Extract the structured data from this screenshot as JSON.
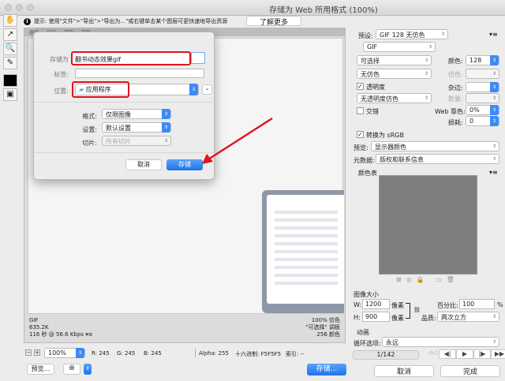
{
  "window": {
    "title": "存储为 Web 所用格式 (100%)"
  },
  "hint": {
    "text": "提示: 使用\"文件\">\"导出\">\"导出为...\"或右键单击某个图层可更快速地导出资源",
    "learn_more": "了解更多"
  },
  "tabs": [
    "原稿",
    "优化",
    "双联",
    "四联"
  ],
  "dialog": {
    "save_as_label": "存储为",
    "save_as_value": "翻书动态效果gif",
    "tags_label": "标签:",
    "location_label": "位置:",
    "location_value": "应用程序",
    "format_label": "格式:",
    "format_value": "仅限图像",
    "settings_label": "设置:",
    "settings_value": "默认设置",
    "slices_label": "切片:",
    "slices_value": "所有切片",
    "cancel": "取消",
    "save": "存储"
  },
  "image_info": {
    "format": "GIF",
    "size": "635.2K",
    "time": "116 秒 @ 56.6 Kbps",
    "dither": "100% 仿色",
    "palette": "\"可选择\" 调板",
    "colors": "256 颜色"
  },
  "status": {
    "zoom": "100%",
    "r": "R: 245",
    "g": "G: 245",
    "b": "B: 245",
    "alpha": "Alpha: 255",
    "hex": "十六进制: F5F5F5",
    "index": "索引: --"
  },
  "bottom": {
    "preview": "预览...",
    "save": "存储...",
    "cancel": "取消",
    "done": "完成"
  },
  "panel": {
    "preset_label": "预设:",
    "preset": "GIF 128 无仿色",
    "format": "GIF",
    "reduction": "可选择",
    "colors_label": "颜色:",
    "colors": "128",
    "dither_algo": "无仿色",
    "dither_label": "仿色:",
    "transparency": "透明度",
    "matte_label": "杂边:",
    "trans_dither": "无透明度仿色",
    "amount_label": "数量:",
    "interlaced": "交错",
    "web_snap_label": "Web 靠色:",
    "web_snap": "0%",
    "lossy_label": "损耗:",
    "lossy": "0",
    "convert_srgb": "转换为 sRGB",
    "preview_label": "预览:",
    "preview": "显示器颜色",
    "metadata_label": "元数据:",
    "metadata": "版权和联系信息",
    "color_table": "颜色表",
    "image_size": "图像大小",
    "w_label": "W:",
    "w": "1200",
    "h_label": "H:",
    "h": "900",
    "px": "像素",
    "percent_label": "百分比:",
    "percent": "100",
    "pct": "%",
    "quality_label": "品质:",
    "quality": "两次立方",
    "animation": "动画",
    "loop_label": "循环选项:",
    "loop": "永远",
    "frame": "1/142"
  },
  "colors": {
    "accent": "#1f74e8",
    "annotation": "#e0141e"
  }
}
